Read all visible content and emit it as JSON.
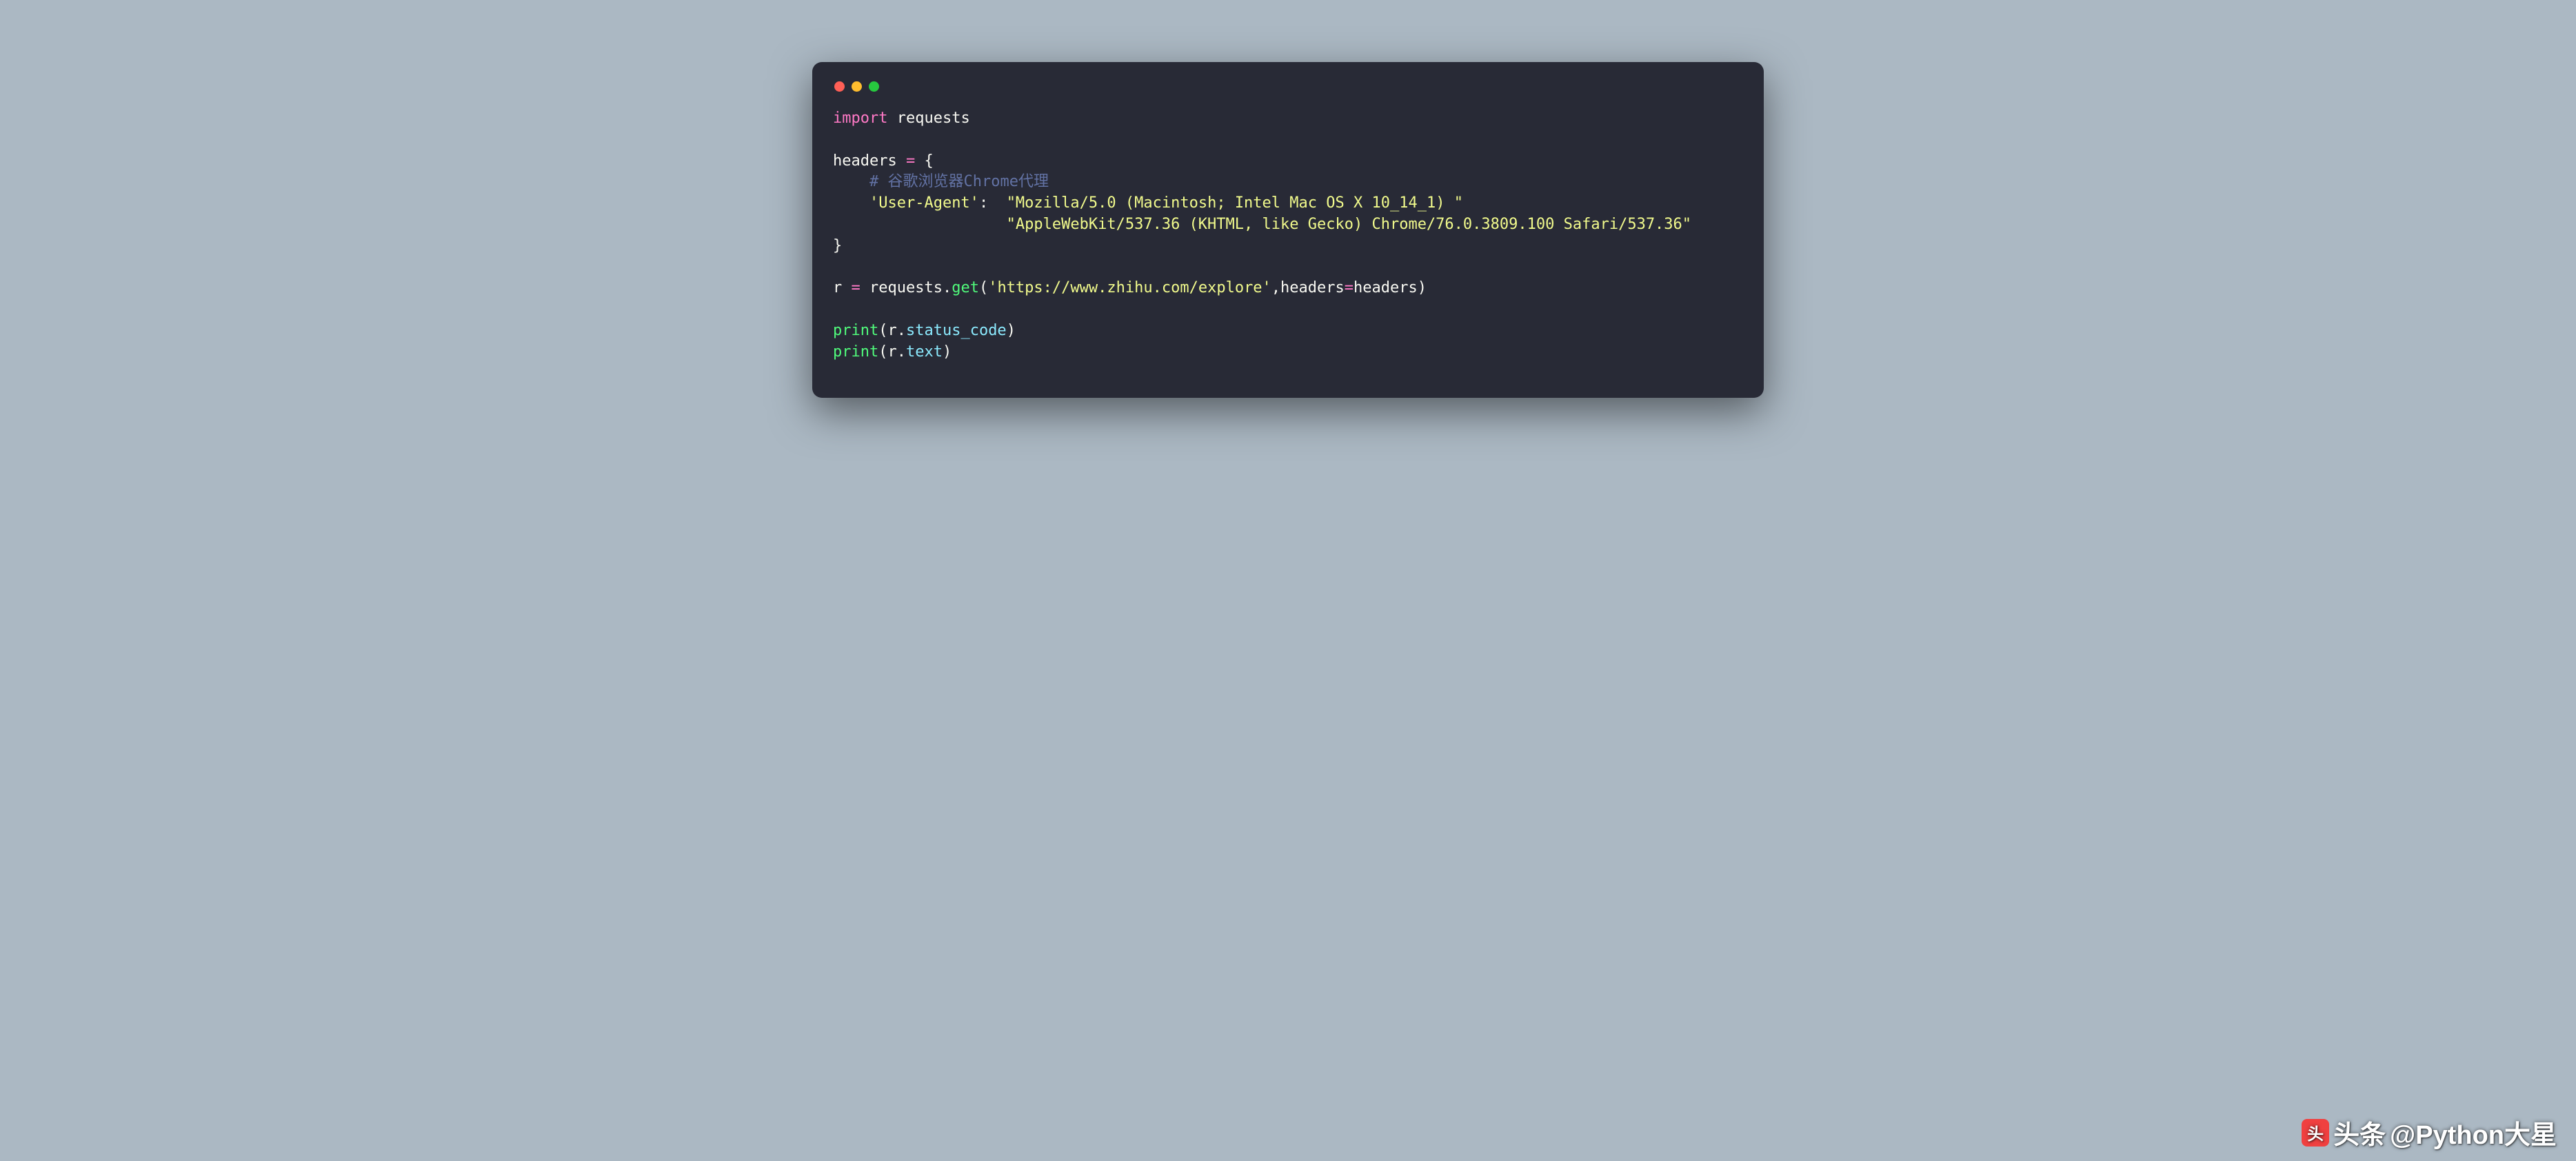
{
  "code": {
    "line1": {
      "kw": "import",
      "mod": " requests"
    },
    "line3a": "headers ",
    "line3b": "=",
    "line3c": " {",
    "line4": "    # 谷歌浏览器Chrome代理",
    "line5a": "    ",
    "line5b": "'User-Agent'",
    "line5c": ":  ",
    "line5d": "\"Mozilla/5.0 (Macintosh; Intel Mac OS X 10_14_1) \"",
    "line6": "                   \"AppleWebKit/537.36 (KHTML, like Gecko) Chrome/76.0.3809.100 Safari/537.36\"",
    "line7": "}",
    "line9a": "r ",
    "line9b": "=",
    "line9c": " requests.",
    "line9d": "get",
    "line9e": "(",
    "line9f": "'https://www.zhihu.com/explore'",
    "line9g": ",headers",
    "line9h": "=",
    "line9i": "headers)",
    "line11a": "print",
    "line11b": "(r.",
    "line11c": "status_code",
    "line11d": ")",
    "line12a": "print",
    "line12b": "(r.",
    "line12c": "text",
    "line12d": ")"
  },
  "watermark": {
    "logo_text": "头",
    "prefix": "头条",
    "handle": "@Python大星"
  }
}
